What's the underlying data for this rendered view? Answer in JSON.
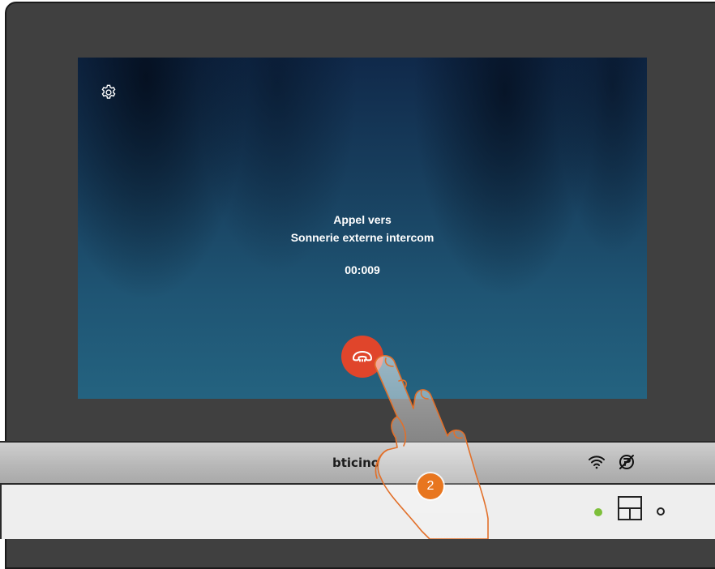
{
  "call": {
    "line1": "Appel vers",
    "line2": "Sonnerie externe intercom",
    "timer": "00:009"
  },
  "device": {
    "brand": "bticino"
  },
  "step": {
    "number": "2"
  },
  "icons": {
    "settings": "gear-icon",
    "hangup": "phone-hangup-icon",
    "wifi": "wifi-icon",
    "mute": "ringtone-off-icon",
    "home": "home-key-icon"
  },
  "colors": {
    "hangup": "#e0452b",
    "badge": "#e8761f",
    "led": "#7dbf3a",
    "frame": "#404040"
  }
}
